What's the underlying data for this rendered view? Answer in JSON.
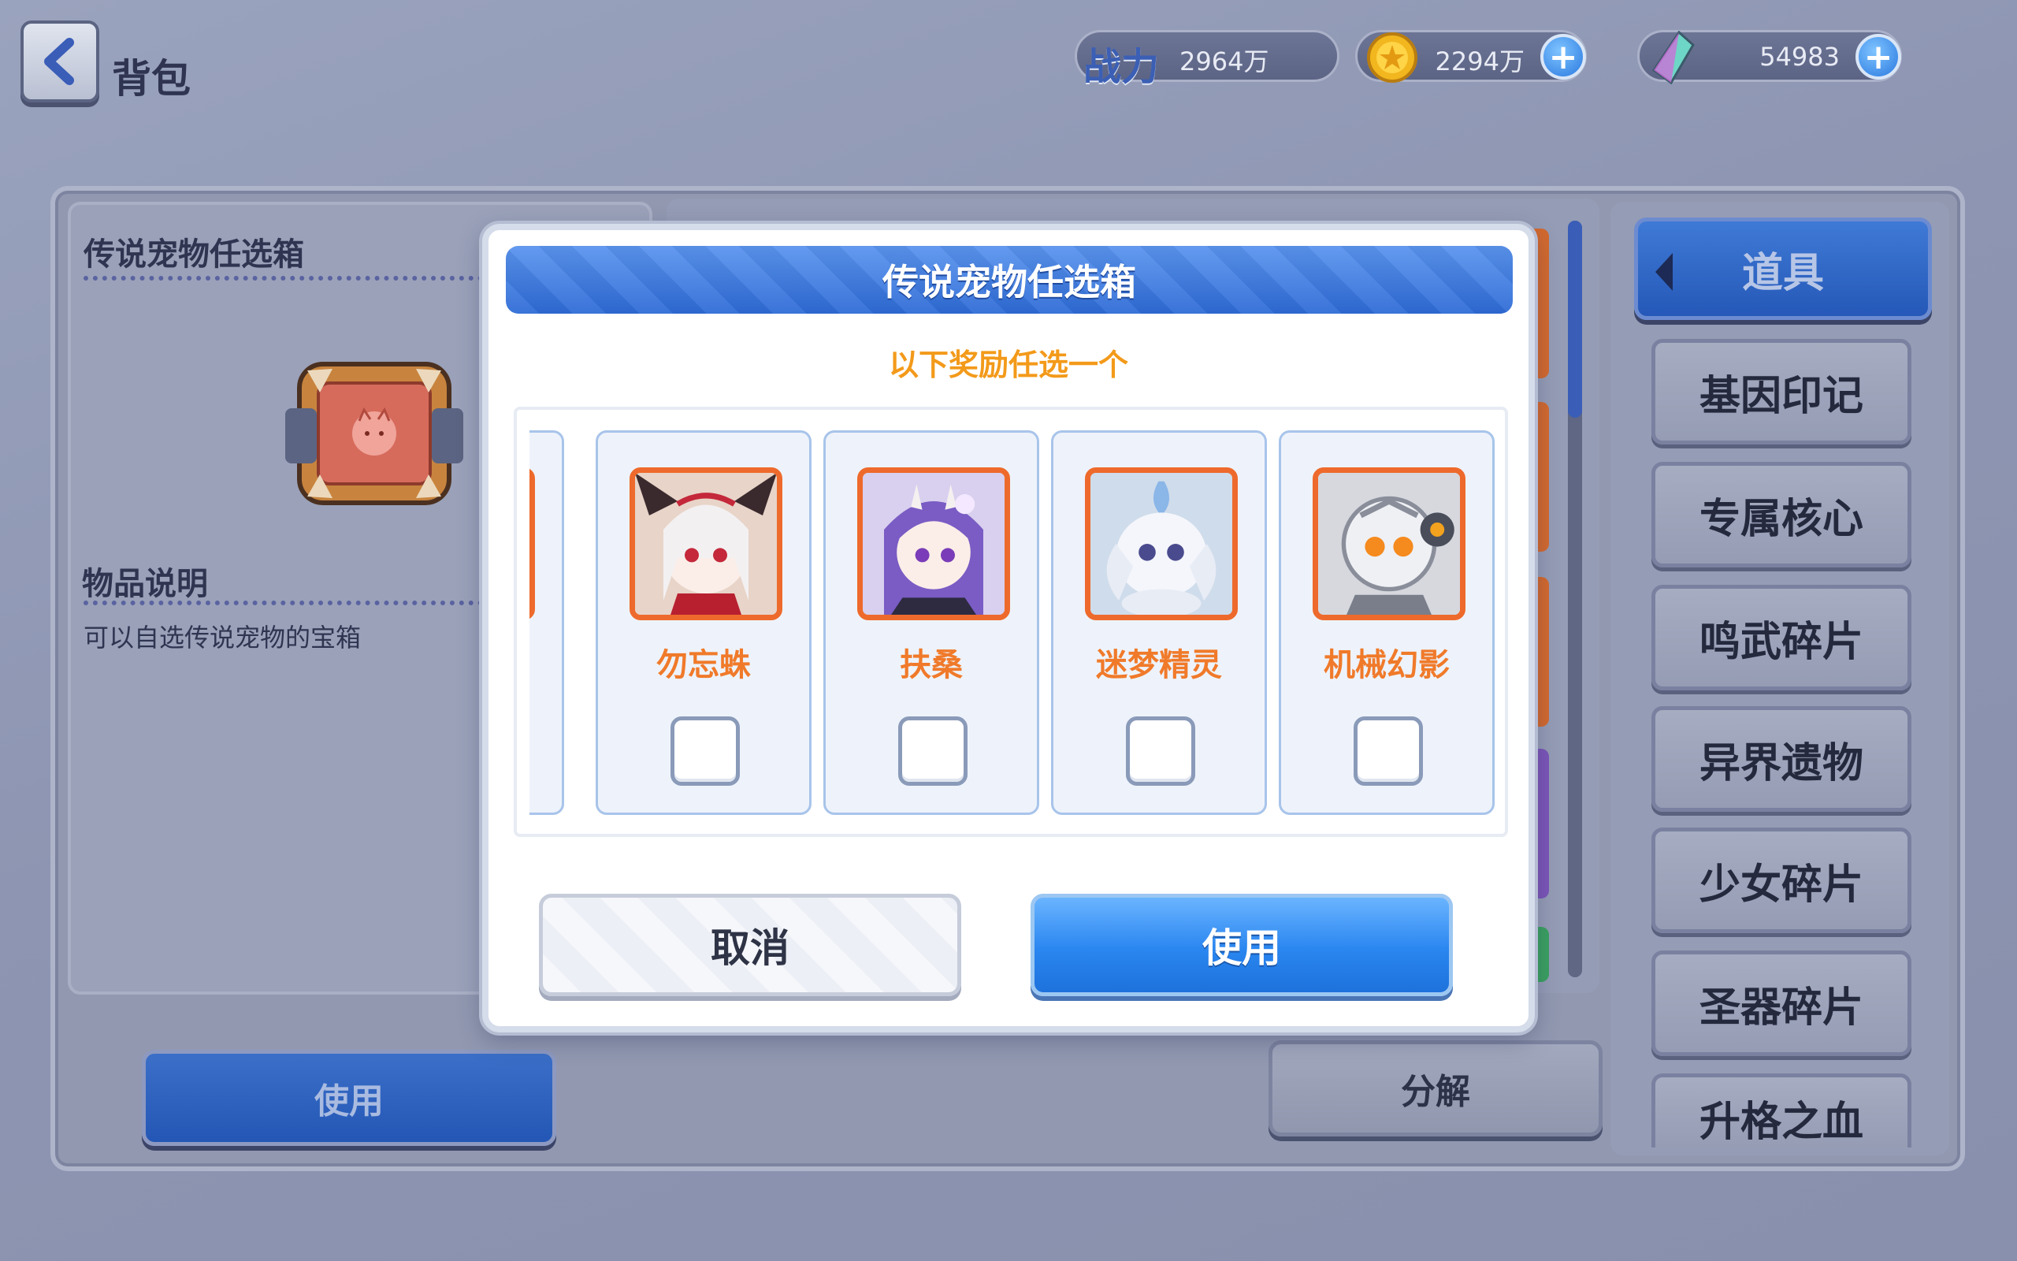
{
  "header": {
    "title": "背包",
    "power": {
      "label": "战力",
      "value": "2964万"
    },
    "gold": {
      "value": "2294万",
      "icon": "gold-coin-icon"
    },
    "gem": {
      "value": "54983",
      "icon": "crystal-gem-icon"
    }
  },
  "item_info": {
    "name": "传说宠物任选箱",
    "desc_heading": "物品说明",
    "description": "可以自选传说宠物的宝箱"
  },
  "buttons": {
    "left_use": "使用",
    "split": "分解"
  },
  "categories": {
    "active": "道具",
    "items": [
      {
        "label": "基因印记"
      },
      {
        "label": "专属核心"
      },
      {
        "label": "鸣武碎片"
      },
      {
        "label": "异界遗物"
      },
      {
        "label": "少女碎片"
      },
      {
        "label": "圣器碎片"
      },
      {
        "label": "升格之血"
      }
    ]
  },
  "modal": {
    "title": "传说宠物任选箱",
    "subtitle": "以下奖励任选一个",
    "rewards": [
      {
        "name": "勿忘蛛",
        "checked": false
      },
      {
        "name": "扶桑",
        "checked": false
      },
      {
        "name": "迷梦精灵",
        "checked": false
      },
      {
        "name": "机械幻影",
        "checked": false
      }
    ],
    "cancel_label": "取消",
    "use_label": "使用"
  },
  "colors": {
    "accent_blue": "#2e6bd6",
    "reward_name_orange": "#f07a2a",
    "subtitle_orange": "#f39a1a",
    "portrait_border": "#ee6a2c"
  }
}
